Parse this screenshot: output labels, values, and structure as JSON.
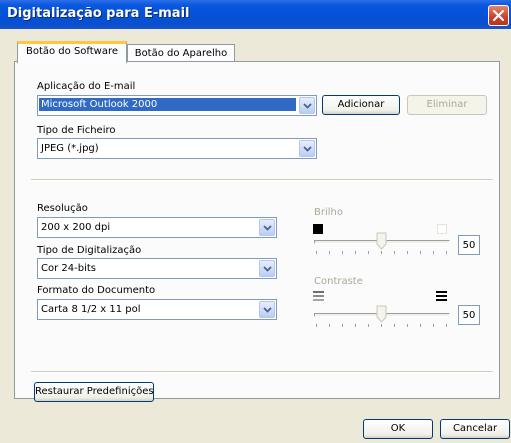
{
  "window": {
    "title": "Digitalização para E-mail"
  },
  "tabs": [
    {
      "label": "Botão do Software",
      "active": true
    },
    {
      "label": "Botão do Aparelho",
      "active": false
    }
  ],
  "email_app": {
    "label": "Aplicação do E-mail",
    "value": "Microsoft Outlook 2000",
    "add_button": "Adicionar",
    "delete_button": "Eliminar"
  },
  "file_type": {
    "label": "Tipo de Ficheiro",
    "value": "JPEG (*.jpg)"
  },
  "resolution": {
    "label": "Resolução",
    "value": "200 x 200 dpi"
  },
  "scan_type": {
    "label": "Tipo de Digitalização",
    "value": "Cor 24-bits"
  },
  "doc_size": {
    "label": "Formato do Documento",
    "value": "Carta 8 1/2 x 11 pol"
  },
  "brightness": {
    "label": "Brilho",
    "value": "50"
  },
  "contrast": {
    "label": "Contraste",
    "value": "50"
  },
  "restore_button": "Restaurar Predefinições",
  "ok_button": "OK",
  "cancel_button": "Cancelar",
  "colors": {
    "titlebar": "#0452d8",
    "selection": "#316ac5",
    "tab_highlight": "#ffc83c"
  }
}
